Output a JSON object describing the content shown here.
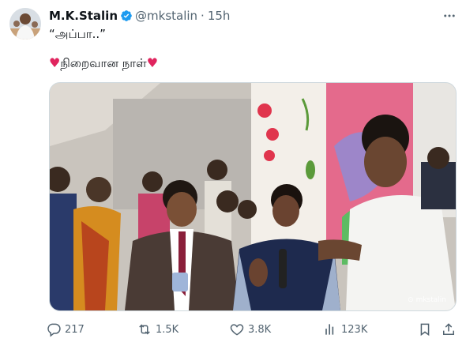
{
  "author": {
    "name": "M.K.Stalin",
    "handle": "@mkstalin",
    "separator": "·",
    "time": "15h"
  },
  "tweet": {
    "line1": "“அப்பா..”",
    "line2_text": "நிறைவான நாள்",
    "heart": "♥"
  },
  "media": {
    "watermark": "⊙ mkstalin"
  },
  "actions": {
    "replies": "217",
    "retweets": "1.5K",
    "likes": "3.8K",
    "views": "123K"
  },
  "colors": {
    "verified": "#1d9bf0",
    "secondary_text": "#536471",
    "heart": "#e0245e"
  }
}
